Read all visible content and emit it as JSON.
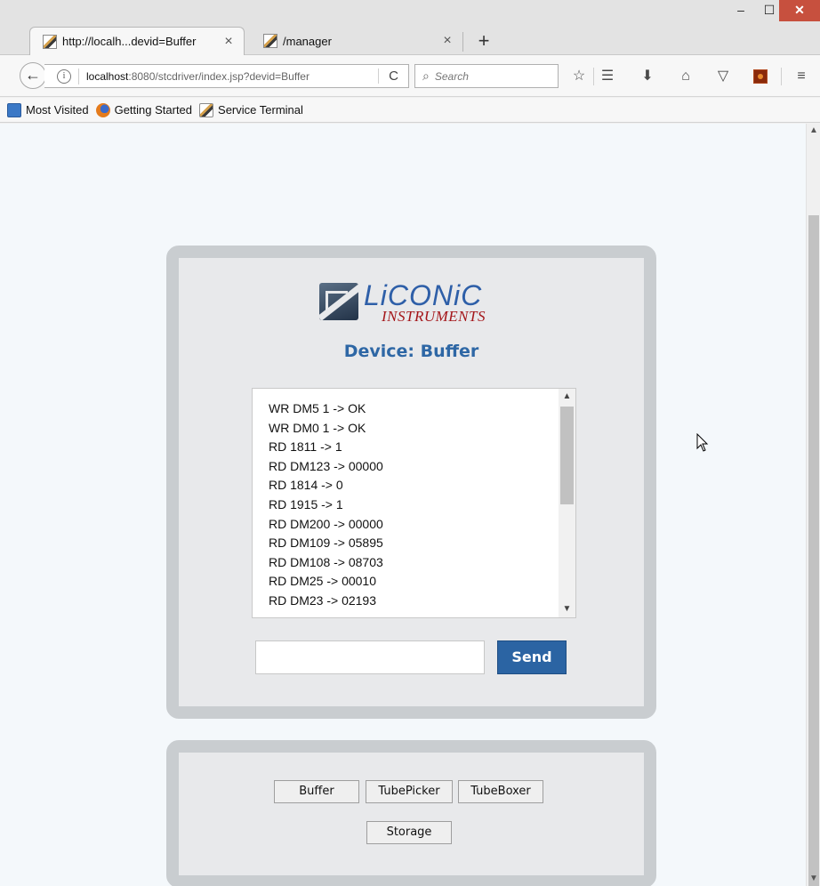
{
  "browser": {
    "tabs": [
      {
        "label": "http://localh...devid=Buffer",
        "close": "×"
      },
      {
        "label": "/manager",
        "close": "×"
      }
    ],
    "new_tab": "+",
    "window_controls": {
      "minimize": "–",
      "maximize": "☐",
      "close": "✕"
    },
    "back_icon": "back-arrow",
    "url": {
      "host": "localhost",
      "rest": ":8080/stcdriver/index.jsp?devid=Buffer"
    },
    "reload": "C",
    "search_placeholder": "Search",
    "toolbar_icons": [
      "star-icon",
      "reading-list-icon",
      "download-icon",
      "home-icon",
      "pocket-icon",
      "extension-icon",
      "menu-icon"
    ],
    "bookmarks": [
      "Most Visited",
      "Getting Started",
      "Service Terminal"
    ]
  },
  "page": {
    "logo": {
      "name": "LiCONiC",
      "sub": "INSTRUMENTS"
    },
    "device_title": "Device: Buffer",
    "log_lines": [
      "WR DM5 1 -> OK",
      "WR DM0 1 -> OK",
      "RD 1811 -> 1",
      "RD DM123 -> 00000",
      "RD 1814 -> 0",
      "RD 1915 -> 1",
      "RD DM200 -> 00000",
      "RD DM109 -> 05895",
      "RD DM108 -> 08703",
      "RD DM25 -> 00010",
      "RD DM23 -> 02193"
    ],
    "command_value": "",
    "send_label": "Send",
    "device_buttons": [
      "Buffer",
      "TubePicker",
      "TubeBoxer",
      "Storage"
    ]
  },
  "colors": {
    "accent": "#2b64a3",
    "panel_border": "#c9cdd0",
    "panel_bg": "#e8e9eb",
    "close_button": "#c7503e"
  }
}
